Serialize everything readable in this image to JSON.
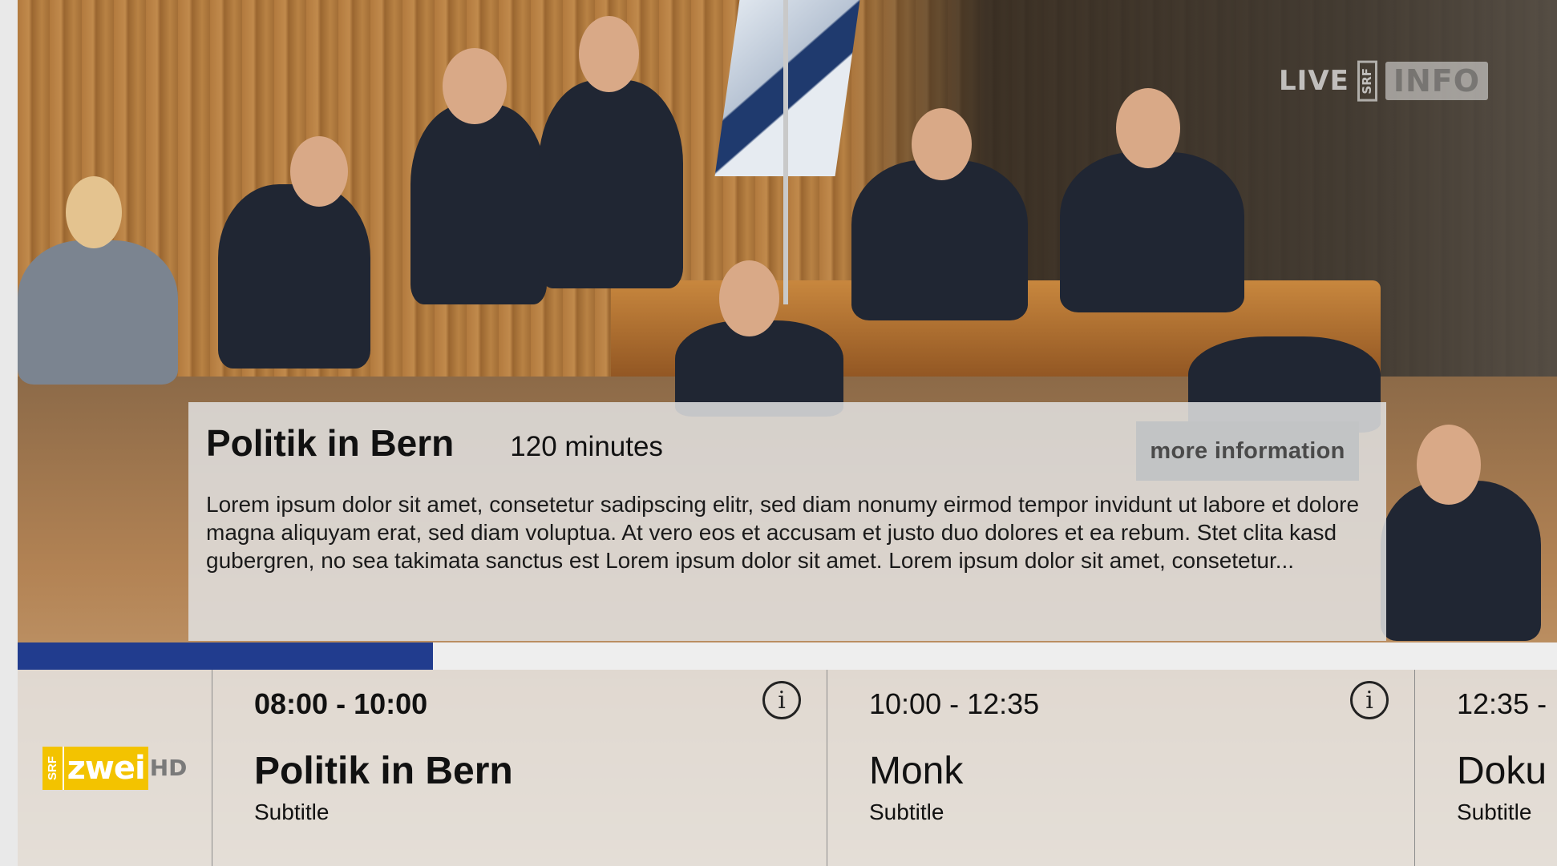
{
  "overlay": {
    "live_label": "LIVE",
    "channel_badge_vertical": "SRF",
    "channel_badge_main": "INFO"
  },
  "info_panel": {
    "title": "Politik in Bern",
    "duration": "120 minutes",
    "more_info_label": "more information",
    "description": "Lorem ipsum dolor sit amet, consetetur sadipscing elitr, sed diam nonumy eirmod tempor invidunt ut labore et dolore magna aliquyam erat, sed diam voluptua. At vero eos et accusam et justo duo dolores et ea rebum. Stet clita kasd gubergren, no sea takimata sanctus est Lorem ipsum dolor sit amet. Lorem ipsum dolor sit amet, consetetur..."
  },
  "progress": {
    "value_percent": 27,
    "fill_color": "#213c8e"
  },
  "channel": {
    "logo_srf": "SRF",
    "logo_name": "zwei",
    "logo_hd": "HD",
    "brand_color": "#f3c300"
  },
  "schedule": [
    {
      "time": "08:00 - 10:00",
      "title": "Politik in Bern",
      "subtitle": "Subtitle",
      "icon": "info-icon",
      "current": true
    },
    {
      "time": "10:00 - 12:35",
      "title": "Monk",
      "subtitle": "Subtitle",
      "icon": "info-icon",
      "current": false
    },
    {
      "time": "12:35 -",
      "title": "Doku",
      "subtitle": "Subtitle",
      "current": false
    }
  ]
}
